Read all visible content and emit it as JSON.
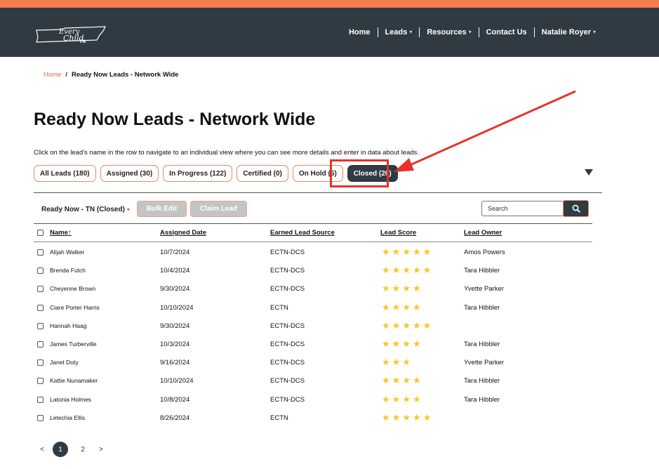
{
  "colors": {
    "accent": "#f47b4a",
    "navbar": "#2f3a42",
    "star": "#f6c81d",
    "annotation": "#e8312a"
  },
  "header": {
    "logo_text": [
      "Every",
      "Child",
      "TN"
    ],
    "nav": [
      {
        "label": "Home",
        "caret": ""
      },
      {
        "label": "Leads",
        "caret": "▾"
      },
      {
        "label": "Resources",
        "caret": "▾"
      },
      {
        "label": "Contact Us",
        "caret": ""
      },
      {
        "label": "Natalie Royer",
        "caret": "▾"
      }
    ]
  },
  "breadcrumb": {
    "home": "Home",
    "separator": "/",
    "current": "Ready Now Leads - Network Wide"
  },
  "page": {
    "title": "Ready Now Leads - Network Wide",
    "instructions": "Click on the lead's name in the row to navigate to an individual view where you can see more details and enter in data about leads."
  },
  "tabs": [
    {
      "label": "All Leads (180)"
    },
    {
      "label": "Assigned (30)"
    },
    {
      "label": "In Progress (122)"
    },
    {
      "label": "Certified (0)"
    },
    {
      "label": "On Hold (5)"
    },
    {
      "label": "Closed (20)"
    }
  ],
  "toolbar": {
    "list_view": "Ready Now - TN (Closed)",
    "list_view_caret": "▾",
    "bulk_edit": "Bulk Edit",
    "claim_lead": "Claim Lead",
    "search_placeholder": "Search"
  },
  "table": {
    "columns": [
      "Name",
      "Assigned Date",
      "Earned Lead Source",
      "Lead Score",
      "Lead Owner"
    ],
    "sort_indicator": "↑",
    "rows": [
      {
        "name": "Alijah Walker",
        "date": "10/7/2024",
        "source": "ECTN-DCS",
        "score": 5,
        "owner": "Amos Powers"
      },
      {
        "name": "Brenda Futch",
        "date": "10/4/2024",
        "source": "ECTN-DCS",
        "score": 5,
        "owner": "Tara Hibbler"
      },
      {
        "name": "Cheyenne Brown",
        "date": "9/30/2024",
        "source": "ECTN-DCS",
        "score": 4,
        "owner": "Yvette Parker"
      },
      {
        "name": "Ciare Porter Harris",
        "date": "10/10/2024",
        "source": "ECTN",
        "score": 4,
        "owner": "Tara Hibbler"
      },
      {
        "name": "Hannah Haag",
        "date": "9/30/2024",
        "source": "ECTN-DCS",
        "score": 5,
        "owner": ""
      },
      {
        "name": "James Turberville",
        "date": "10/3/2024",
        "source": "ECTN-DCS",
        "score": 4,
        "owner": "Tara Hibbler"
      },
      {
        "name": "Janet Doty",
        "date": "9/16/2024",
        "source": "ECTN-DCS",
        "score": 3,
        "owner": "Yvette Parker"
      },
      {
        "name": "Kattie Nunamaker",
        "date": "10/10/2024",
        "source": "ECTN-DCS",
        "score": 4,
        "owner": "Tara Hibbler"
      },
      {
        "name": "Latonia Holmes",
        "date": "10/8/2024",
        "source": "ECTN-DCS",
        "score": 4,
        "owner": "Tara Hibbler"
      },
      {
        "name": "Letechia Ellis",
        "date": "8/26/2024",
        "source": "ECTN",
        "score": 5,
        "owner": ""
      }
    ]
  },
  "pagination": {
    "prev": "<",
    "pages": [
      "1",
      "2"
    ],
    "current": "1",
    "next": ">"
  }
}
